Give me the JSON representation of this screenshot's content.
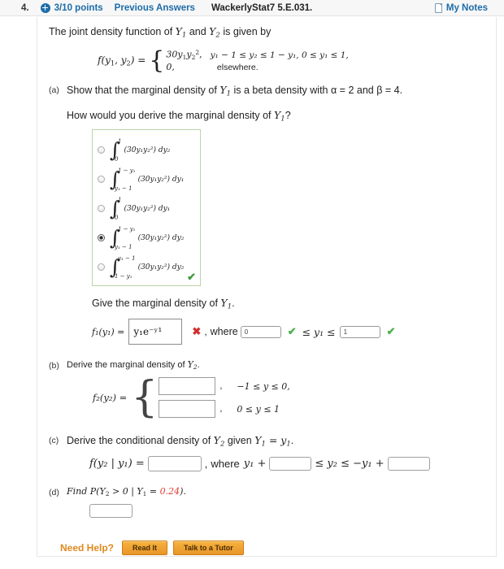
{
  "header": {
    "question_number": "4.",
    "points": "3/10 points",
    "previous_answers": "Previous Answers",
    "book_reference": "WackerlyStat7 5.E.031.",
    "my_notes": "My Notes",
    "plus_icon": "plus-circle-icon",
    "notes_icon": "document-icon"
  },
  "problem": {
    "intro_1": "The joint density function of ",
    "intro_var1": "Y",
    "intro_sub1": "1",
    "intro_2": " and ",
    "intro_var2": "Y",
    "intro_sub2": "2",
    "intro_3": " is given by",
    "function_label": "f(y",
    "function_label_sub1": "1",
    "function_label_mid": ", y",
    "function_label_sub2": "2",
    "function_label_end": ") =",
    "case1_expr": "30y",
    "case1_sub1": "1",
    "case1_var2": "y",
    "case1_sub2": "2",
    "case1_pow": "2",
    "case1_comma": ",",
    "case1_condition": "y₁ − 1 ≤ y₂ ≤ 1 − y₁, 0 ≤ y₁ ≤ 1,",
    "case2_expr": "0,",
    "case2_condition": "elsewhere."
  },
  "parts": {
    "a": {
      "label": "(a)",
      "title_1": "Show that the marginal density of ",
      "title_var": "Y",
      "title_sub": "1",
      "title_2": " is a beta density with α = 2 and β = 4.",
      "question_1": "How would you derive the marginal density of ",
      "question_var": "Y",
      "question_sub": "1",
      "question_2": "?",
      "options": [
        {
          "id": "option-1",
          "selected": false,
          "upper": "1",
          "lower": "0",
          "integrand": "(30y₁y₂²) dy₂"
        },
        {
          "id": "option-2",
          "selected": false,
          "upper": "1 − y₁",
          "lower": "y₁ − 1",
          "integrand": "(30y₁y₂²) dy₁"
        },
        {
          "id": "option-3",
          "selected": false,
          "upper": "1",
          "lower": "0",
          "integrand": "(30y₁y₂²) dy₁"
        },
        {
          "id": "option-4",
          "selected": true,
          "upper": "1 − y₁",
          "lower": "y₁ − 1",
          "integrand": "(30y₁y₂²) dy₂"
        },
        {
          "id": "option-5",
          "selected": false,
          "upper": "y₁ − 1",
          "lower": "1 − y₁",
          "integrand": "(30y₁y₂²) dy₂"
        }
      ],
      "options_correct_mark": "✔",
      "give_marginal_1": "Give the marginal density of ",
      "give_marginal_var": "Y",
      "give_marginal_sub": "1",
      "give_marginal_2": ".",
      "answer_label": "f₁(y₁) =",
      "answer_value": "y₁e⁻ʸ¹",
      "answer_mark": "✖",
      "answer_mark_color": "#cf3030",
      "comma": ",",
      "where_label": "where",
      "lower_value": "0",
      "lower_mark": "✔",
      "middle_label": "≤ y₁ ≤",
      "upper_value": "1",
      "upper_mark": "✔",
      "mark_color": "#4caf50"
    },
    "b": {
      "label": "(b)",
      "title_1": "Derive the marginal density of ",
      "title_var": "Y",
      "title_sub": "2",
      "title_2": ".",
      "function_label": "f₂(y₂) =",
      "row1_value": "",
      "row1_comma": ",",
      "row1_condition": "−1 ≤ y ≤ 0,",
      "row2_value": "",
      "row2_comma": ",",
      "row2_condition": "0 ≤ y ≤ 1"
    },
    "c": {
      "label": "(c)",
      "title_1": "Derive the conditional density of ",
      "title_var1": "Y",
      "title_sub1": "2",
      "title_2": " given ",
      "title_var2": "Y",
      "title_sub2": "1",
      "title_3": " = y",
      "title_sub3": "1",
      "title_4": ".",
      "function_label": "f(y₂ | y₁) =",
      "answer_value": "",
      "comma": ",",
      "where_label": "where",
      "lhs_label": "y₁ +",
      "lower_value": "",
      "middle_label": "≤ y₂ ≤ −y₁ +",
      "upper_value": ""
    },
    "d": {
      "label": "(d)",
      "title_1": "Find P(Y",
      "title_sub1": "2",
      "title_2": " > 0 | Y",
      "title_sub2": "1",
      "title_3": " = ",
      "title_value": "0.24",
      "title_4": ").",
      "value_color": "#e03c31",
      "answer_value": ""
    }
  },
  "footer": {
    "need_help": "Need Help?",
    "read_it": "Read It",
    "talk_to_tutor": "Talk to a Tutor"
  }
}
